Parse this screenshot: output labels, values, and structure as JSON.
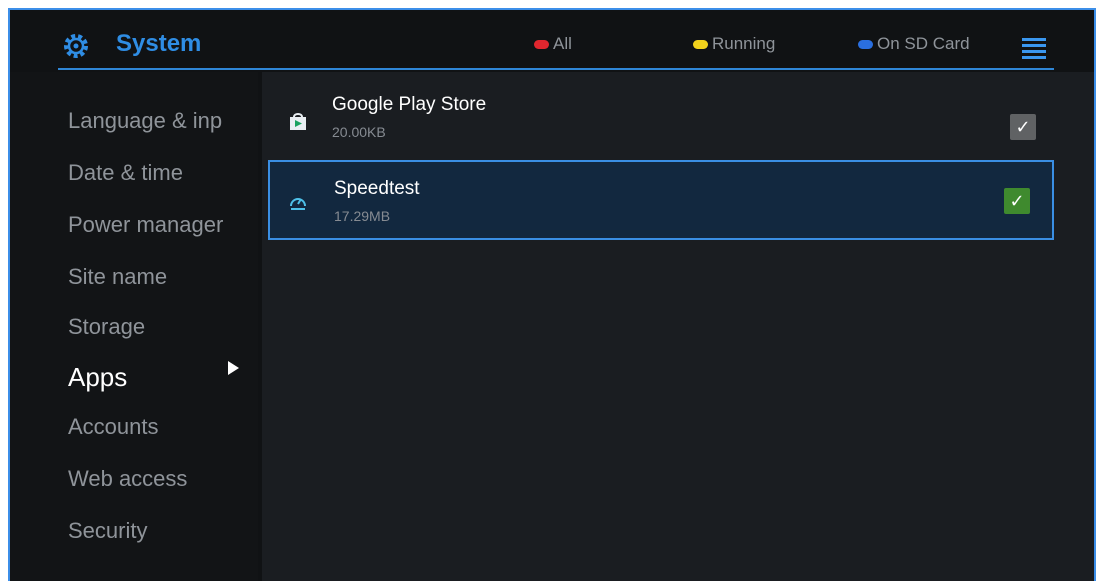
{
  "header": {
    "title": "System",
    "icon": "gear-icon",
    "filters": [
      {
        "label": "All",
        "color": "#e0262e"
      },
      {
        "label": "Running",
        "color": "#f2d21c"
      },
      {
        "label": "On SD Card",
        "color": "#2a6fe0"
      }
    ],
    "menu_icon": "menu-icon"
  },
  "sidebar": {
    "items": [
      {
        "label": "Language & inp"
      },
      {
        "label": "Date & time"
      },
      {
        "label": "Power manager"
      },
      {
        "label": "Site name"
      },
      {
        "label": "Storage"
      },
      {
        "label": "Apps",
        "selected": true
      },
      {
        "label": "Accounts"
      },
      {
        "label": "Web access"
      },
      {
        "label": "Security"
      }
    ]
  },
  "apps": [
    {
      "name": "Google Play Store",
      "size": "20.00KB",
      "icon": "play-store-icon",
      "checked": true,
      "check_color": "#606264"
    },
    {
      "name": "Speedtest",
      "size": "17.29MB",
      "icon": "speedtest-icon",
      "checked": true,
      "check_color": "#3f8a2e"
    }
  ]
}
